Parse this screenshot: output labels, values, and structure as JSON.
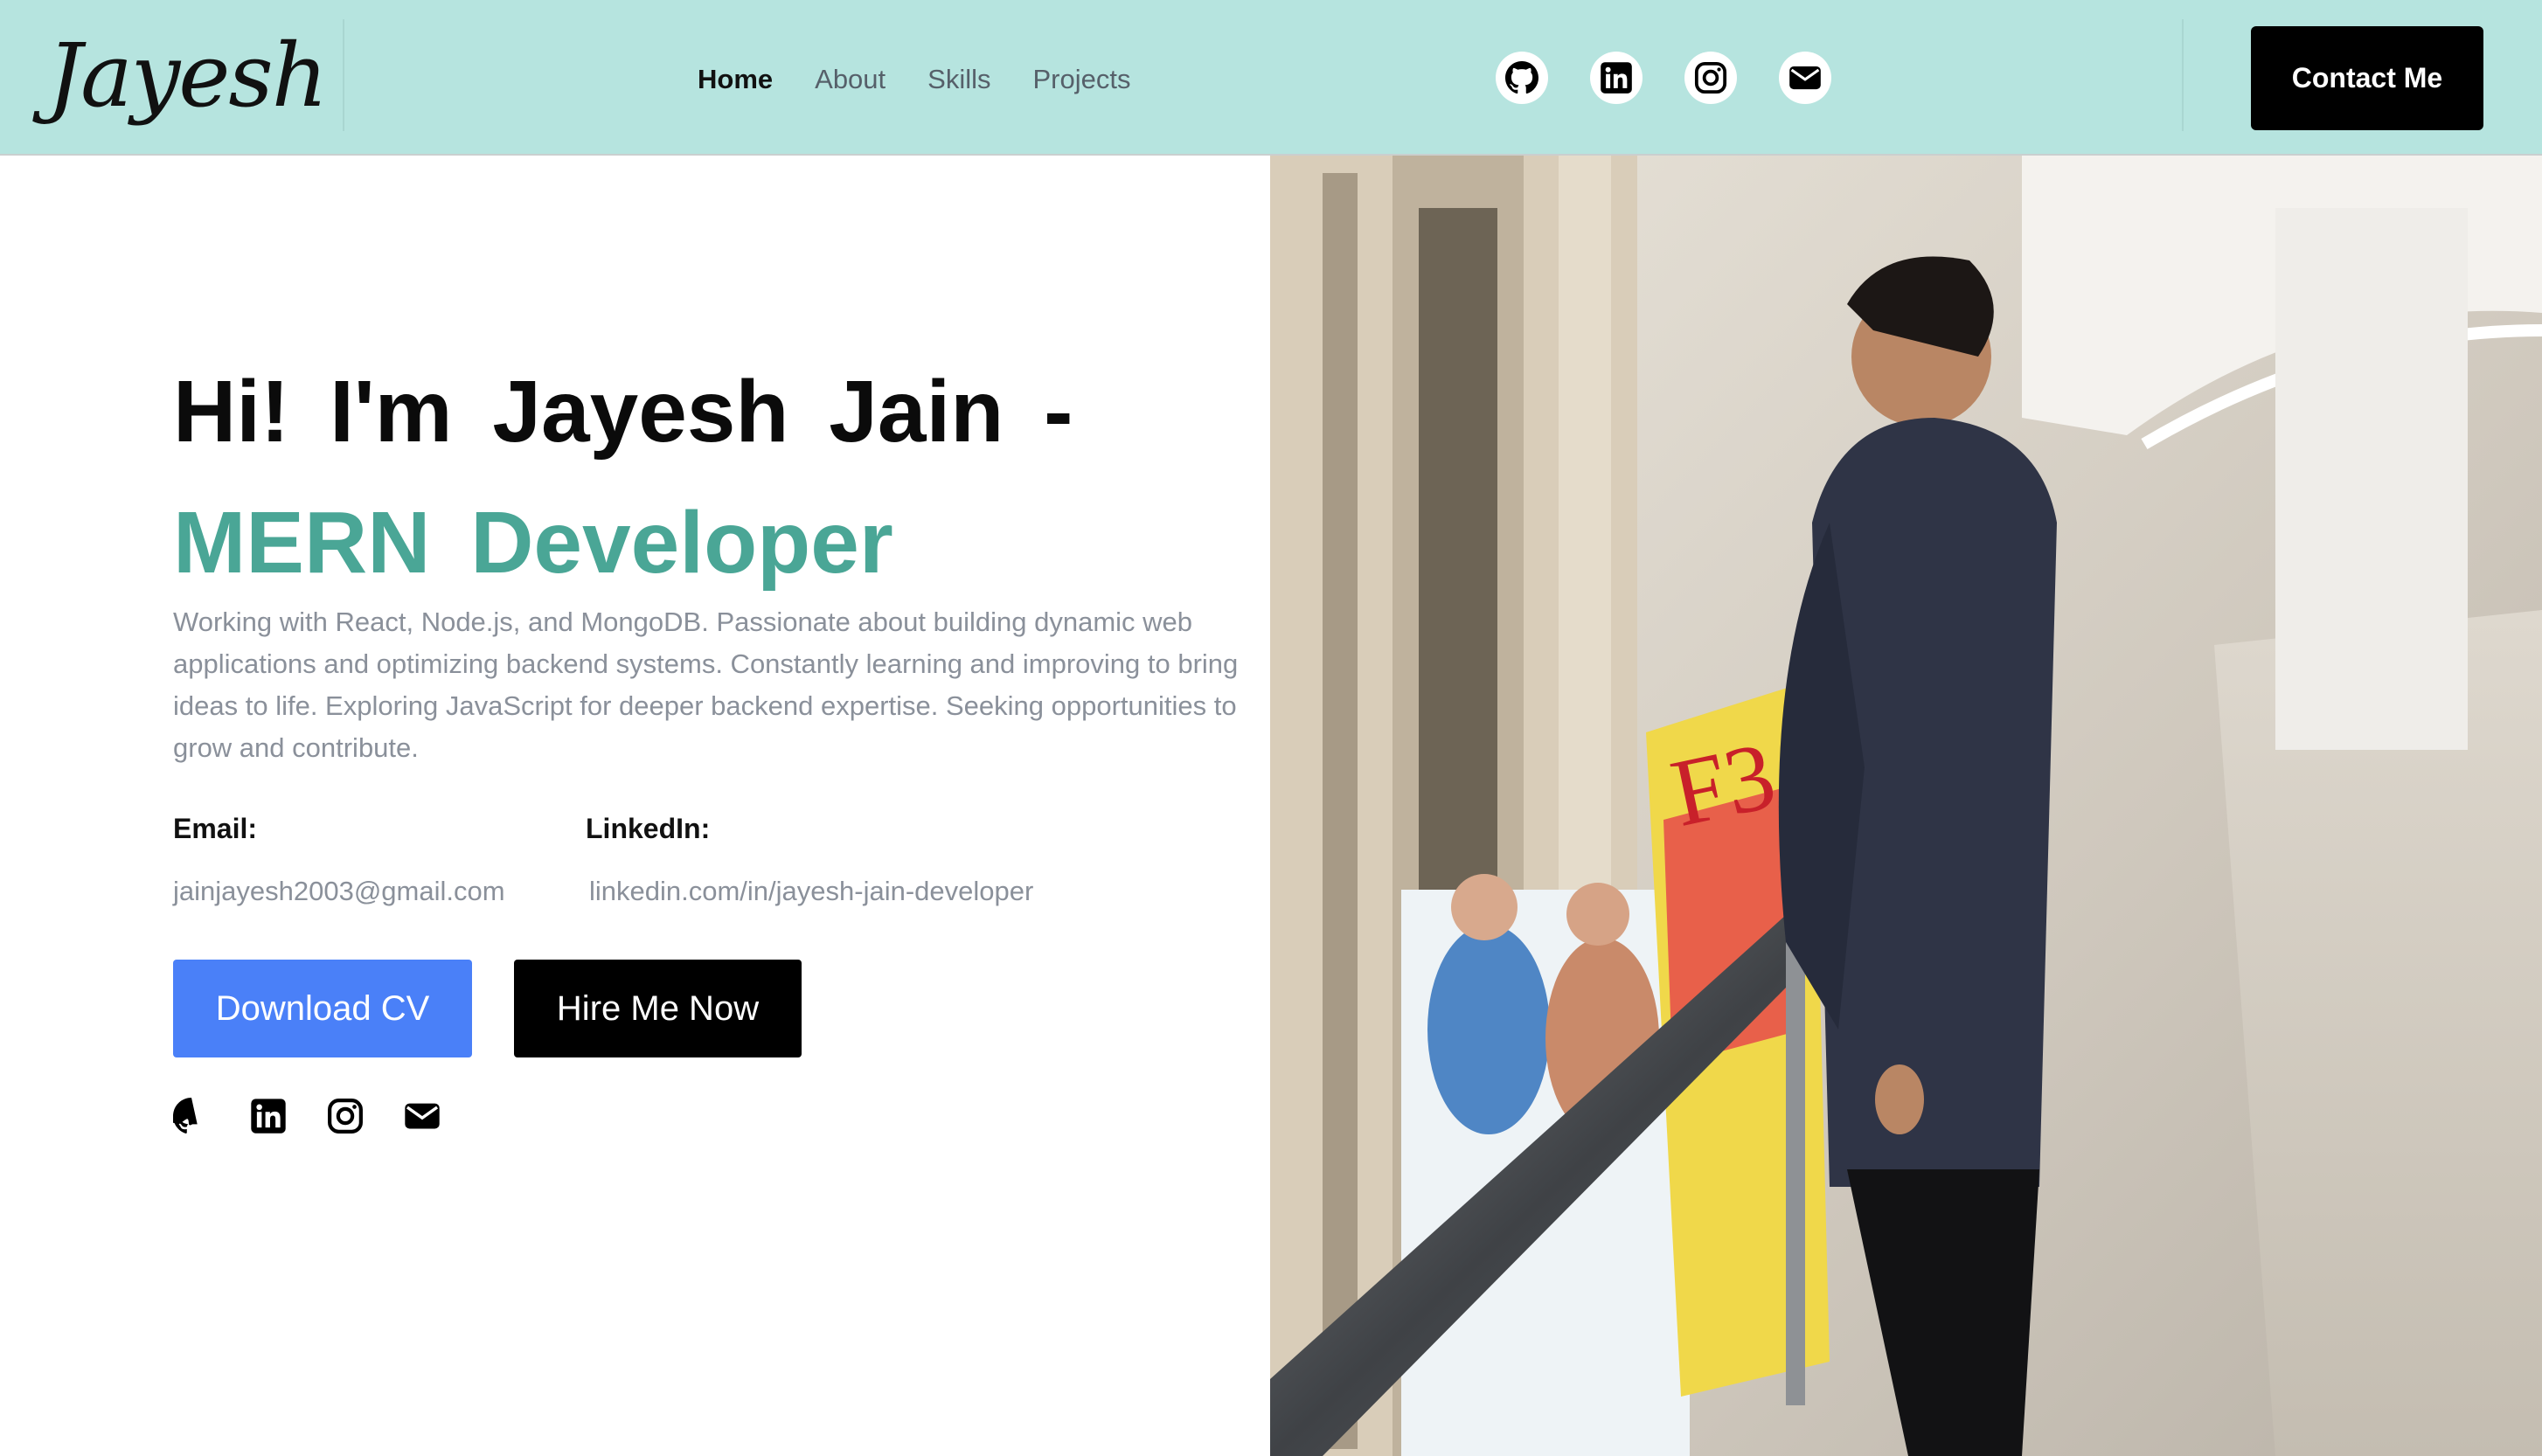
{
  "nav": {
    "logo": "Jayesh",
    "links": [
      {
        "label": "Home",
        "active": true
      },
      {
        "label": "About",
        "active": false
      },
      {
        "label": "Skills",
        "active": false
      },
      {
        "label": "Projects",
        "active": false
      }
    ],
    "icons": [
      "github-icon",
      "linkedin-icon",
      "instagram-icon",
      "mail-icon"
    ],
    "contact_label": "Contact Me"
  },
  "hero": {
    "greeting": "Hi! I'm Jayesh Jain -",
    "role": "MERN Developer",
    "description": "Working with React, Node.js, and MongoDB. Passionate about building dynamic web applications and optimizing backend systems. Constantly learning and improving to bring ideas to life. Exploring JavaScript for deeper backend expertise. Seeking opportunities to grow and contribute.",
    "email_label": "Email:",
    "email_value": "jainjayesh2003@gmail.com",
    "linkedin_label": "LinkedIn:",
    "linkedin_value": "linkedin.com/in/jayesh-jain-developer",
    "download_label": "Download CV",
    "hire_label": "Hire Me Now",
    "social_icons": [
      "github-icon",
      "linkedin-icon",
      "instagram-icon",
      "mail-icon"
    ]
  },
  "photo": {
    "sign_text": "F3"
  },
  "colors": {
    "nav_bg": "#b6e4df",
    "accent": "#4aa696",
    "primary_button": "#4a80f8",
    "dark_button": "#000000",
    "muted_text": "#8a909a"
  }
}
